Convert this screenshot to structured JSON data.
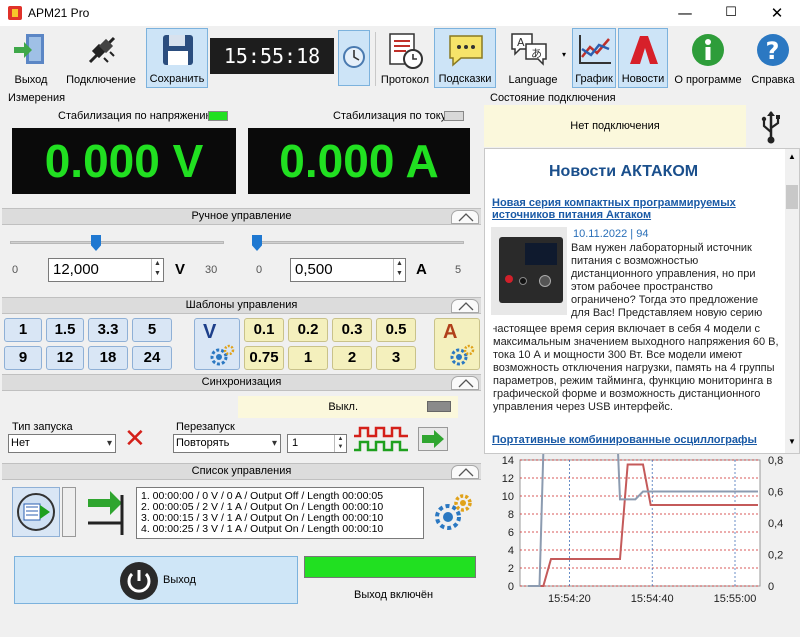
{
  "window": {
    "title": "APM21 Pro",
    "min": "—",
    "max": "☐",
    "close": "✕"
  },
  "toolbar": {
    "exit": "Выход",
    "connect": "Подключение",
    "save": "Сохранить",
    "clock": "15:55:18",
    "protocol": "Протокол",
    "hints": "Подсказки",
    "language": "Language",
    "graph": "График",
    "news": "Новости",
    "about": "О программе",
    "help": "Справка"
  },
  "measure": {
    "title": "Измерения",
    "cv_label": "Стабилизация по напряжению",
    "cc_label": "Стабилизация по току",
    "voltage": "0.000 V",
    "current": "0.000 A"
  },
  "manual": {
    "title": "Ручное управление",
    "v_min": "0",
    "v_value": "12,000",
    "v_unit": "V",
    "v_max": "30",
    "a_min": "0",
    "a_value": "0,500",
    "a_unit": "A",
    "a_max": "5",
    "v_slider_pct": 40,
    "a_slider_pct": 10
  },
  "templates": {
    "title": "Шаблоны управления",
    "v_presets": [
      "1",
      "1.5",
      "3.3",
      "5",
      "9",
      "12",
      "18",
      "24"
    ],
    "v_btn": "V",
    "a_presets": [
      "0.1",
      "0.2",
      "0.3",
      "0.5",
      "0.75",
      "1",
      "2",
      "3"
    ],
    "a_btn": "A"
  },
  "sync": {
    "title": "Синхронизация",
    "status": "Выкл.",
    "launch_label": "Тип запуска",
    "launch_value": "Нет",
    "restart_label": "Перезапуск",
    "restart_value": "Повторять",
    "count": "1"
  },
  "controlList": {
    "title": "Список управления",
    "items": [
      "1. 00:00:00 / 0 V / 0 A / Output Off / Length 00:00:05",
      "2. 00:00:05 / 2 V / 1 A / Output On / Length 00:00:10",
      "3. 00:00:15 / 3 V / 1 A / Output On / Length 00:00:10",
      "4. 00:00:25 / 3 V / 1 A / Output On / Length 00:00:10"
    ]
  },
  "output": {
    "button": "Выход",
    "status": "Выход включён"
  },
  "connection": {
    "title": "Состояние подключения",
    "status": "Нет подключения"
  },
  "news": {
    "header": "Новости АКТАКОМ",
    "item1_title": "Новая серия компактных программируемых источников питания Актаком",
    "item1_date": "10.11.2022 | 94",
    "item1_text": "Вам нужен лабораторный источник питания с возможностью дистанционного управления, но при этом рабочее пространство ограничено? Тогда это предложение для Вас! Представляем новую серию программируемых источников питания Актаком APS-11xx. В настоящее время серия включает в себя 4 модели с максимальным значением выходного напряжения 60 В, тока 10 А и мощности 300 Вт. Все модели имеют возможность отключения нагрузки, память на 4 группы параметров, режим тайминга, функцию мониторинга в графической форме и возможность дистанционного управления через USB интерфейс.",
    "item2_title": "Портативные комбинированные осциллографы"
  },
  "chart_data": {
    "type": "line",
    "x": [
      "15:54:20",
      "15:54:40",
      "15:55:00"
    ],
    "ylim_left": [
      0,
      14
    ],
    "ylim_right": [
      0,
      0.8
    ],
    "yticks_left": [
      "0",
      "2",
      "4",
      "6",
      "8",
      "10",
      "12",
      "14"
    ],
    "yticks_right": [
      "0",
      "0,2",
      "0,4",
      "0,6",
      "0,8"
    ],
    "series": [
      {
        "color": "#c45a5a",
        "values": [
          [
            0,
            0
          ],
          [
            2,
            0
          ],
          [
            3,
            3
          ],
          [
            12,
            3
          ],
          [
            13,
            13.5
          ],
          [
            15,
            13.5
          ],
          [
            16,
            9
          ],
          [
            30,
            9
          ]
        ]
      },
      {
        "color": "#8c9bb0",
        "values": [
          [
            0,
            0
          ],
          [
            1.5,
            0
          ],
          [
            2.5,
            1.7
          ],
          [
            11,
            1.7
          ],
          [
            12,
            0.55
          ],
          [
            14,
            0.55
          ],
          [
            15,
            0.6
          ],
          [
            30,
            0.6
          ]
        ]
      }
    ],
    "grid": true,
    "colors": {
      "left_axis": "#c45a5a",
      "right_axis": "#5a7fb0"
    }
  }
}
